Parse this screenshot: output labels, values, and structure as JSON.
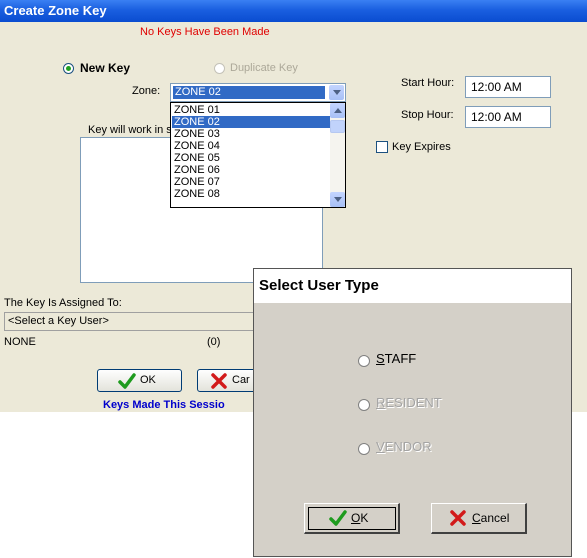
{
  "window": {
    "title": "Create Zone Key",
    "warning": "No Keys Have Been Made"
  },
  "key_mode": {
    "new_key_label": "New Key",
    "duplicate_key_label": "Duplicate Key",
    "selected": "New Key"
  },
  "zone": {
    "label": "Zone:",
    "selected_value": "ZONE 02",
    "options": [
      "ZONE 01",
      "ZONE 02",
      "ZONE 03",
      "ZONE 04",
      "ZONE 05",
      "ZONE 06",
      "ZONE 07",
      "ZONE 08"
    ]
  },
  "schedule": {
    "start_hour_label": "Start Hour:",
    "start_hour_value": "12:00 AM",
    "stop_hour_label": "Stop Hour:",
    "stop_hour_value": "12:00 AM",
    "key_expires_label": "Key Expires"
  },
  "key_will_work_label": "Key will work in s",
  "assigned": {
    "label": "The Key Is Assigned To:",
    "select_user_placeholder": "<Select a Key User>",
    "user_value": "NONE",
    "count": "(0)"
  },
  "buttons": {
    "ok_label": "OK",
    "cancel_label": "Car"
  },
  "session_text": "Keys Made This Sessio",
  "dialog": {
    "title": "Select User Type",
    "options": [
      {
        "label_first": "S",
        "label_rest": "TAFF",
        "enabled": true
      },
      {
        "label_first": "R",
        "label_rest": "ESIDENT",
        "enabled": false
      },
      {
        "label_first": "V",
        "label_rest": "ENDOR",
        "enabled": false
      }
    ],
    "ok_first": "O",
    "ok_rest": "K",
    "cancel_first": "C",
    "cancel_rest": "ancel"
  },
  "colors": {
    "title_bar": "#0a4cd0",
    "warning_text": "#e00000",
    "selection": "#316ac5",
    "session_text": "#0000cc"
  }
}
